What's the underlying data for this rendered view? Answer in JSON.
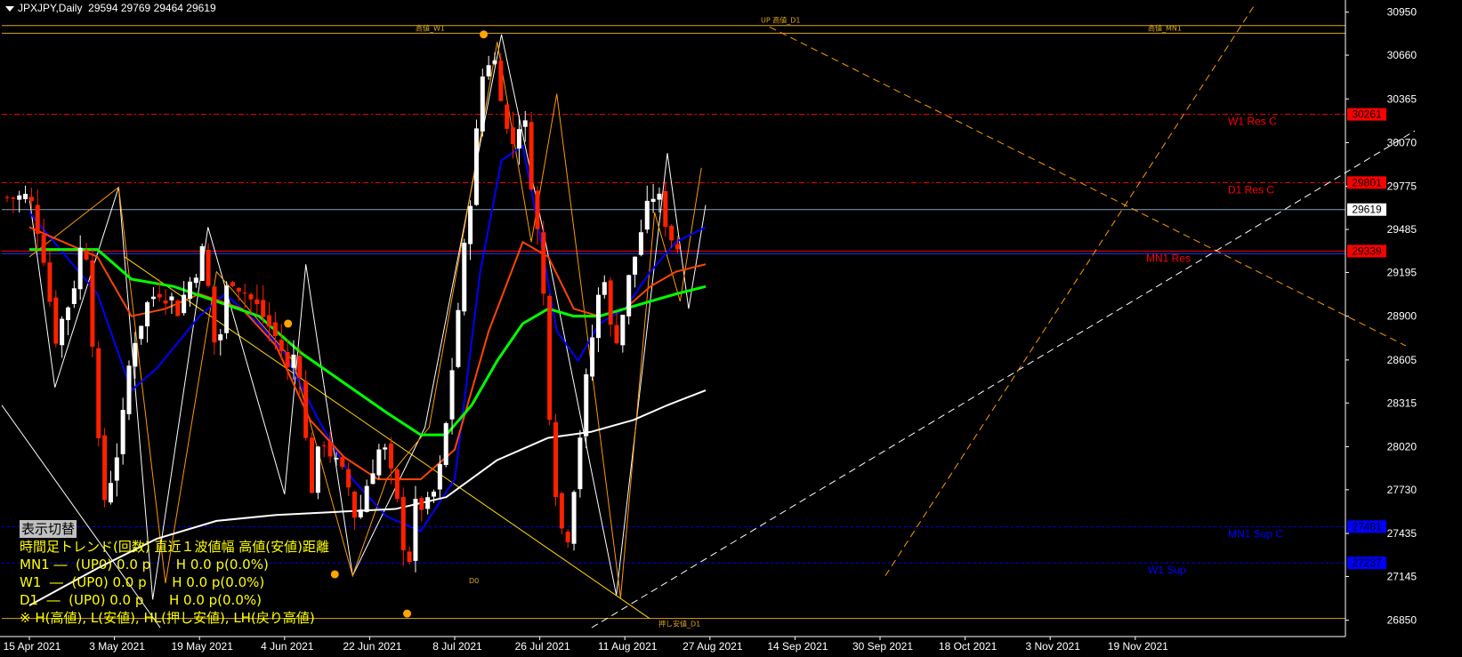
{
  "header": {
    "symbol": "JPXJPY,Daily",
    "ohlc": "29594 29769 29464 29619"
  },
  "colors": {
    "background": "#000000",
    "bull_candle": "#ffffff",
    "bear_candle": "#ff2000",
    "ma_blue": "#0000ff",
    "ma_orange": "#ff4500",
    "ma_green": "#00ff00",
    "ma_white": "#ffffff",
    "level_gold": "#ffd700",
    "level_red": "#ff0000",
    "level_blue": "#0000ff",
    "trendline_orange": "#ff9900",
    "zigzag_white": "#ffffff"
  },
  "price_axis": {
    "ticks": [
      "30950",
      "30660",
      "30365",
      "30070",
      "29775",
      "29485",
      "29195",
      "28900",
      "28605",
      "28315",
      "28020",
      "27730",
      "27435",
      "27145",
      "26850"
    ],
    "current_price": "29619",
    "badges": [
      {
        "value": "30261",
        "kind": "res"
      },
      {
        "value": "29801",
        "kind": "res"
      },
      {
        "value": "29339",
        "kind": "res"
      },
      {
        "value": "27481",
        "kind": "sup"
      },
      {
        "value": "27237",
        "kind": "sup"
      }
    ]
  },
  "levels": [
    {
      "label": "W1 Res C",
      "price": 30261,
      "color": "#ff0000"
    },
    {
      "label": "D1 Res C",
      "price": 29801,
      "color": "#ff0000"
    },
    {
      "label": "MN1 Res",
      "price": 29339,
      "color": "#ff0000"
    },
    {
      "label": "MN1 Sup C",
      "price": 27481,
      "color": "#0000ff"
    },
    {
      "label": "W1 Sup",
      "price": 27237,
      "color": "#0000ff"
    }
  ],
  "level_small_labels": [
    "高値_W1",
    "高値_MN1",
    "UP 高値_D1",
    "押し安値_D1",
    "D0"
  ],
  "time_axis": [
    "15 Apr 2021",
    "3 May 2021",
    "19 May 2021",
    "4 Jun 2021",
    "22 Jun 2021",
    "8 Jul 2021",
    "26 Jul 2021",
    "11 Aug 2021",
    "27 Aug 2021",
    "14 Sep 2021",
    "30 Sep 2021",
    "18 Oct 2021",
    "3 Nov 2021",
    "19 Nov 2021"
  ],
  "info_panel": {
    "toggle_label": "表示切替",
    "title": "時間足トレンド(回数) 直近１波値幅 高値(安値)距離",
    "rows": [
      "MN1 ―  (UP0) 0.0 p      H 0.0 p(0.0%)",
      "W1  ―  (UP0) 0.0 p      H 0.0 p(0.0%)",
      "D1  ―  (UP0) 0.0 p      H 0.0 p(0.0%)"
    ],
    "note": "※ H(高値), L(安値), HL(押し安値), LH(戻り高値)"
  },
  "chart_data": {
    "type": "candlestick",
    "title": "JPXJPY,Daily",
    "ylim": [
      26770,
      31020
    ],
    "x": [
      "15 Apr 2021",
      "3 May 2021",
      "19 May 2021",
      "4 Jun 2021",
      "22 Jun 2021",
      "8 Jul 2021",
      "26 Jul 2021",
      "11 Aug 2021",
      "27 Aug 2021",
      "14 Sep 2021",
      "30 Sep 2021",
      "18 Oct 2021",
      "3 Nov 2021",
      "19 Nov 2021"
    ],
    "close_path": [
      [
        0,
        29700
      ],
      [
        0.15,
        29400
      ],
      [
        0.3,
        28750
      ],
      [
        0.5,
        29050
      ],
      [
        0.65,
        29500
      ],
      [
        0.75,
        28700
      ],
      [
        0.85,
        27600
      ],
      [
        1.0,
        27900
      ],
      [
        1.1,
        28200
      ],
      [
        1.2,
        28700
      ],
      [
        1.4,
        29000
      ],
      [
        1.55,
        29100
      ],
      [
        1.75,
        28950
      ],
      [
        1.9,
        29150
      ],
      [
        2.05,
        29350
      ],
      [
        2.2,
        28600
      ],
      [
        2.35,
        29200
      ],
      [
        2.55,
        29050
      ],
      [
        2.75,
        28900
      ],
      [
        2.95,
        28700
      ],
      [
        3.05,
        28500
      ],
      [
        3.15,
        28750
      ],
      [
        3.3,
        27700
      ],
      [
        3.45,
        28100
      ],
      [
        3.6,
        27900
      ],
      [
        3.75,
        27750
      ],
      [
        3.85,
        27500
      ],
      [
        4.0,
        27850
      ],
      [
        4.15,
        28050
      ],
      [
        4.3,
        27700
      ],
      [
        4.45,
        27200
      ],
      [
        4.55,
        27650
      ],
      [
        4.7,
        27600
      ],
      [
        4.85,
        27900
      ],
      [
        5.05,
        29000
      ],
      [
        5.2,
        29800
      ],
      [
        5.35,
        30650
      ],
      [
        5.5,
        30600
      ],
      [
        5.65,
        30000
      ],
      [
        5.8,
        30300
      ],
      [
        5.95,
        29600
      ],
      [
        6.05,
        29000
      ],
      [
        6.15,
        27900
      ],
      [
        6.3,
        27300
      ],
      [
        6.45,
        28000
      ],
      [
        6.6,
        28700
      ],
      [
        6.75,
        29250
      ],
      [
        6.85,
        28700
      ],
      [
        6.95,
        28850
      ],
      [
        7.05,
        29150
      ],
      [
        7.2,
        29500
      ],
      [
        7.35,
        29750
      ],
      [
        7.45,
        29600
      ],
      [
        7.6,
        29350
      ],
      [
        7.75,
        29500
      ],
      [
        7.85,
        29650
      ],
      [
        7.95,
        29619
      ]
    ],
    "moving_averages": [
      {
        "color": "#0000ff",
        "points": [
          [
            0,
            29600
          ],
          [
            0.8,
            29050
          ],
          [
            1.2,
            28400
          ],
          [
            1.5,
            28550
          ],
          [
            2.0,
            28900
          ],
          [
            2.3,
            29050
          ],
          [
            2.7,
            28850
          ],
          [
            3.0,
            28650
          ],
          [
            3.4,
            28200
          ],
          [
            3.8,
            27800
          ],
          [
            4.2,
            27550
          ],
          [
            4.6,
            27450
          ],
          [
            5.0,
            27800
          ],
          [
            5.3,
            29200
          ],
          [
            5.55,
            29950
          ],
          [
            5.8,
            30050
          ],
          [
            6.0,
            29450
          ],
          [
            6.2,
            28800
          ],
          [
            6.45,
            28600
          ],
          [
            6.7,
            28850
          ],
          [
            7.0,
            28950
          ],
          [
            7.3,
            29200
          ],
          [
            7.6,
            29400
          ],
          [
            7.95,
            29500
          ]
        ]
      },
      {
        "color": "#ff4500",
        "points": [
          [
            0,
            29500
          ],
          [
            0.8,
            29300
          ],
          [
            1.2,
            28900
          ],
          [
            1.6,
            28950
          ],
          [
            2.0,
            29050
          ],
          [
            2.5,
            28950
          ],
          [
            2.9,
            28700
          ],
          [
            3.3,
            28200
          ],
          [
            3.7,
            27950
          ],
          [
            4.1,
            27800
          ],
          [
            4.6,
            27800
          ],
          [
            5.0,
            28000
          ],
          [
            5.4,
            28800
          ],
          [
            5.8,
            29400
          ],
          [
            6.1,
            29300
          ],
          [
            6.4,
            28950
          ],
          [
            6.7,
            28900
          ],
          [
            7.0,
            28950
          ],
          [
            7.3,
            29100
          ],
          [
            7.6,
            29200
          ],
          [
            7.95,
            29250
          ]
        ]
      },
      {
        "color": "#00ff00",
        "points": [
          [
            0,
            29350
          ],
          [
            0.8,
            29350
          ],
          [
            1.2,
            29150
          ],
          [
            1.7,
            29100
          ],
          [
            2.2,
            29000
          ],
          [
            2.7,
            28900
          ],
          [
            3.2,
            28650
          ],
          [
            3.7,
            28450
          ],
          [
            4.2,
            28250
          ],
          [
            4.6,
            28100
          ],
          [
            4.9,
            28100
          ],
          [
            5.2,
            28300
          ],
          [
            5.5,
            28600
          ],
          [
            5.8,
            28850
          ],
          [
            6.1,
            28950
          ],
          [
            6.4,
            28900
          ],
          [
            6.7,
            28900
          ],
          [
            7.0,
            28950
          ],
          [
            7.3,
            29000
          ],
          [
            7.6,
            29050
          ],
          [
            7.95,
            29100
          ]
        ]
      },
      {
        "color": "#ffffff",
        "points": [
          [
            0,
            26950
          ],
          [
            0.8,
            27200
          ],
          [
            1.5,
            27400
          ],
          [
            2.2,
            27520
          ],
          [
            2.9,
            27560
          ],
          [
            3.6,
            27580
          ],
          [
            4.3,
            27600
          ],
          [
            4.9,
            27680
          ],
          [
            5.5,
            27930
          ],
          [
            6.1,
            28080
          ],
          [
            6.6,
            28120
          ],
          [
            7.1,
            28200
          ],
          [
            7.5,
            28300
          ],
          [
            7.95,
            28400
          ]
        ]
      }
    ]
  }
}
